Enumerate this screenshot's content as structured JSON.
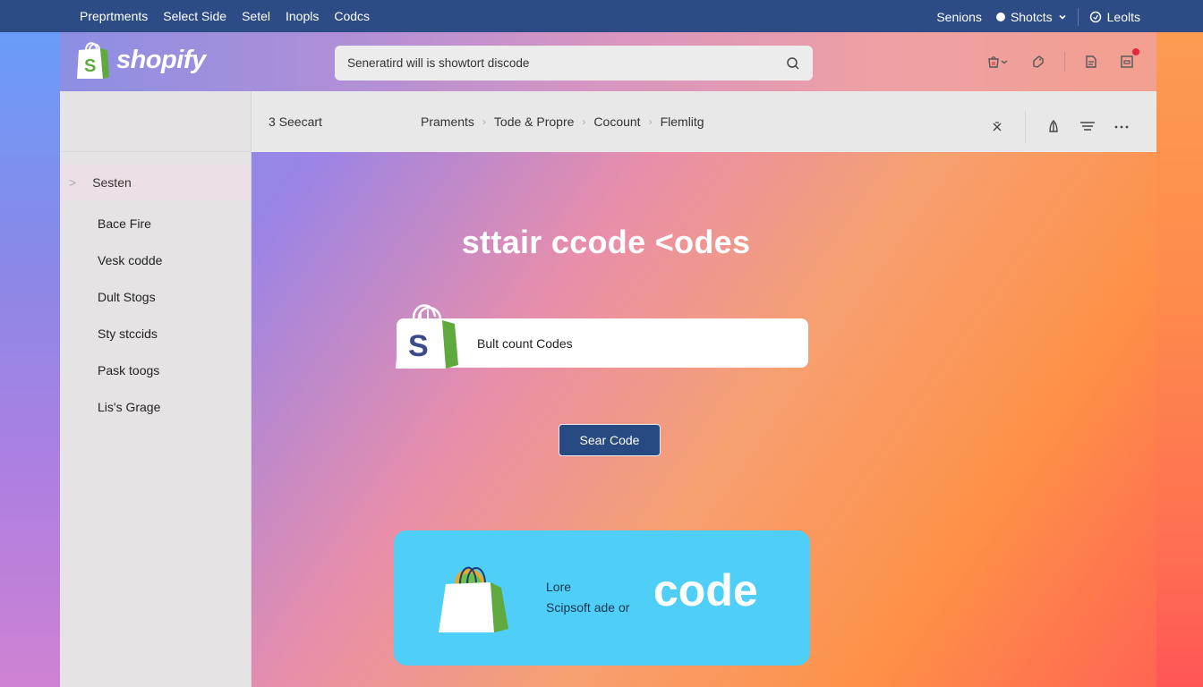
{
  "topbar": {
    "menu": [
      "Preprtments",
      "Select Side",
      "Setel",
      "Inopls",
      "Codcs"
    ],
    "right": {
      "sessions": "Senions",
      "shortcuts": "Shotcts",
      "looks": "Leolts"
    }
  },
  "header": {
    "logo_text": "shopify",
    "search_value": "Seneratird will is showtort discode",
    "icons": [
      "cart-icon",
      "tag-icon",
      "notes-icon",
      "inbox-icon"
    ]
  },
  "toolbar": {
    "count": "3 Seecart",
    "breadcrumbs": [
      "Praments",
      "Tode & Propre",
      "Cocount",
      "Flemlitg"
    ]
  },
  "sidebar": {
    "active": "Sesten",
    "items": [
      "Bace Fire",
      "Vesk codde",
      "Dult Stogs",
      "Sty stccids",
      "Pask toogs",
      "Lis's Grage"
    ]
  },
  "main": {
    "headline": "sttair ccode <odes",
    "input_value": "Bult count Codes",
    "button_label": "Sear Code",
    "promo": {
      "line1": "Lore",
      "line2": "Scipsoft ade or",
      "code": "code"
    }
  },
  "colors": {
    "topbar": "#2d4c86",
    "button": "#274a82",
    "promo": "#4fcff8",
    "shopify_green": "#5fa93e",
    "badge": "#e8263a"
  }
}
